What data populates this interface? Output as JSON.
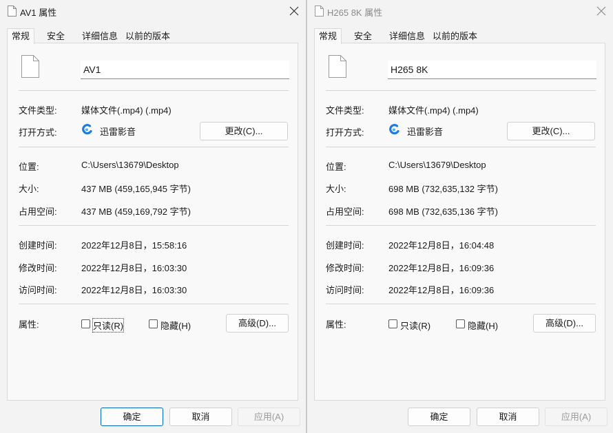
{
  "left": {
    "title": "AV1 属性",
    "tabs": [
      "常规",
      "安全",
      "详细信息",
      "以前的版本"
    ],
    "file_name": "AV1",
    "rows": {
      "type_label": "文件类型:",
      "type_value": "媒体文件(.mp4) (.mp4)",
      "open_label": "打开方式:",
      "open_app": "迅雷影音",
      "change_button": "更改(C)...",
      "location_label": "位置:",
      "location_value": "C:\\Users\\13679\\Desktop",
      "size_label": "大小:",
      "size_value": "437 MB (459,165,945 字节)",
      "disk_label": "占用空间:",
      "disk_value": "437 MB (459,169,792 字节)",
      "created_label": "创建时间:",
      "created_value": "2022年12月8日，15:58:16",
      "modified_label": "修改时间:",
      "modified_value": "2022年12月8日，16:03:30",
      "accessed_label": "访问时间:",
      "accessed_value": "2022年12月8日，16:03:30",
      "attr_label": "属性:",
      "readonly_label": "只读(R)",
      "hidden_label": "隐藏(H)",
      "advanced_button": "高级(D)..."
    },
    "footer": {
      "ok": "确定",
      "cancel": "取消",
      "apply": "应用(A)"
    }
  },
  "right": {
    "title": "H265 8K 属性",
    "tabs": [
      "常规",
      "安全",
      "详细信息",
      "以前的版本"
    ],
    "file_name": "H265 8K",
    "rows": {
      "type_label": "文件类型:",
      "type_value": "媒体文件(.mp4) (.mp4)",
      "open_label": "打开方式:",
      "open_app": "迅雷影音",
      "change_button": "更改(C)...",
      "location_label": "位置:",
      "location_value": "C:\\Users\\13679\\Desktop",
      "size_label": "大小:",
      "size_value": "698 MB (732,635,132 字节)",
      "disk_label": "占用空间:",
      "disk_value": "698 MB (732,635,136 字节)",
      "created_label": "创建时间:",
      "created_value": "2022年12月8日，16:04:48",
      "modified_label": "修改时间:",
      "modified_value": "2022年12月8日，16:09:36",
      "accessed_label": "访问时间:",
      "accessed_value": "2022年12月8日，16:09:36",
      "attr_label": "属性:",
      "readonly_label": "只读(R)",
      "hidden_label": "隐藏(H)",
      "advanced_button": "高级(D)..."
    },
    "footer": {
      "ok": "确定",
      "cancel": "取消",
      "apply": "应用(A)"
    }
  },
  "icons": {
    "document": "document-icon",
    "close": "close-icon",
    "app": "xunlei-player-icon"
  },
  "colors": {
    "accent": "#0067c0",
    "app_blue": "#1e7be0",
    "disabled_text": "#9a9a9a"
  }
}
